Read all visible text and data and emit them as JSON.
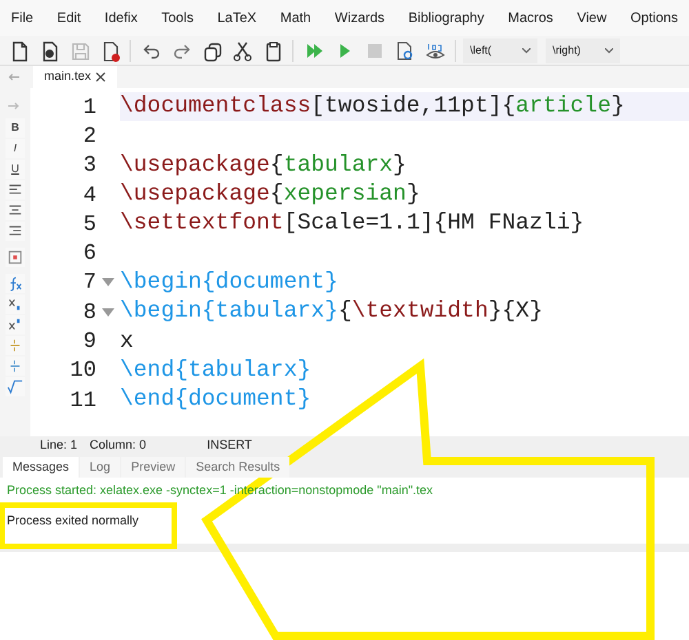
{
  "menu": [
    "File",
    "Edit",
    "Idefix",
    "Tools",
    "LaTeX",
    "Math",
    "Wizards",
    "Bibliography",
    "Macros",
    "View",
    "Options"
  ],
  "toolbar": {
    "buttons": [
      {
        "kind": "new"
      },
      {
        "kind": "open"
      },
      {
        "kind": "save",
        "disabled": true
      },
      {
        "kind": "close"
      },
      {
        "kind": "undo"
      },
      {
        "kind": "redo"
      },
      {
        "kind": "copy"
      },
      {
        "kind": "cut"
      },
      {
        "kind": "paste"
      },
      {
        "kind": "build"
      },
      {
        "kind": "compile"
      },
      {
        "kind": "stop",
        "disabled": true
      },
      {
        "kind": "view"
      },
      {
        "kind": "log"
      }
    ],
    "dropdowns": [
      "\\left(",
      "\\right)"
    ]
  },
  "tabs": [
    {
      "label": "main.tex",
      "selected": true
    }
  ],
  "sidebar": [
    {
      "kind": "bold",
      "label": "B"
    },
    {
      "kind": "italic",
      "label": "I"
    },
    {
      "kind": "underline",
      "label": "U"
    },
    {
      "kind": "align-left"
    },
    {
      "kind": "align-center"
    },
    {
      "kind": "align-right"
    },
    {
      "kind": "image"
    },
    {
      "kind": "function"
    },
    {
      "kind": "subscript"
    },
    {
      "kind": "superscript"
    },
    {
      "kind": "fraction"
    },
    {
      "kind": "fraction2"
    },
    {
      "kind": "sqrt"
    }
  ],
  "editor": {
    "lines": [
      {
        "number": "1",
        "current": true,
        "foldable": false,
        "segments": [
          {
            "kind": "cmd",
            "text": "\\documentclass"
          },
          {
            "kind": "plain",
            "text": "[twoside,11pt]{"
          },
          {
            "kind": "pkg",
            "text": "article"
          },
          {
            "kind": "plain",
            "text": "}"
          }
        ]
      },
      {
        "number": "2",
        "current": false,
        "foldable": false
      },
      {
        "number": "3",
        "current": false,
        "foldable": false,
        "segments": [
          {
            "kind": "cmd",
            "text": "\\usepackage"
          },
          {
            "kind": "plain",
            "text": "{"
          },
          {
            "kind": "pkg",
            "text": "tabularx"
          },
          {
            "kind": "plain",
            "text": "}"
          }
        ]
      },
      {
        "number": "4",
        "current": false,
        "foldable": false,
        "segments": [
          {
            "kind": "cmd",
            "text": "\\usepackage"
          },
          {
            "kind": "plain",
            "text": "{"
          },
          {
            "kind": "pkg",
            "text": "xepersian"
          },
          {
            "kind": "plain",
            "text": "}"
          }
        ]
      },
      {
        "number": "5",
        "current": false,
        "foldable": false,
        "segments": [
          {
            "kind": "cmd",
            "text": "\\settextfont"
          },
          {
            "kind": "plain",
            "text": "[Scale=1.1]{HM FNazli}"
          }
        ]
      },
      {
        "number": "6",
        "current": false,
        "foldable": false
      },
      {
        "number": "7",
        "current": false,
        "foldable": true,
        "segments": [
          {
            "kind": "env",
            "text": "\\begin{document}"
          }
        ]
      },
      {
        "number": "8",
        "current": false,
        "foldable": true,
        "segments": [
          {
            "kind": "env",
            "text": "\\begin{tabularx}"
          },
          {
            "kind": "plain",
            "text": "{"
          },
          {
            "kind": "cmd",
            "text": "\\textwidth"
          },
          {
            "kind": "plain",
            "text": "}{X}"
          }
        ]
      },
      {
        "number": "9",
        "current": false,
        "foldable": false,
        "segments": [
          {
            "kind": "plain",
            "text": "x"
          }
        ]
      },
      {
        "number": "10",
        "current": false,
        "foldable": false,
        "segments": [
          {
            "kind": "env",
            "text": "\\end{tabularx}"
          }
        ]
      },
      {
        "number": "11",
        "current": false,
        "foldable": false,
        "segments": [
          {
            "kind": "env",
            "text": "\\end{document}"
          }
        ]
      }
    ]
  },
  "status_bar": {
    "line": "Line: 1",
    "column": "Column: 0",
    "mode": "INSERT"
  },
  "messages": {
    "tabs": [
      {
        "label": "Messages",
        "selected": true
      },
      {
        "label": "Log",
        "selected": false
      },
      {
        "label": "Preview",
        "selected": false
      },
      {
        "label": "Search Results",
        "selected": false
      }
    ],
    "lines": [
      {
        "kind": "info",
        "text": "Process started: xelatex.exe -synctex=1 -interaction=nonstopmode \"main\".tex"
      },
      {
        "kind": "plain",
        "text": "Process exited normally"
      }
    ]
  }
}
